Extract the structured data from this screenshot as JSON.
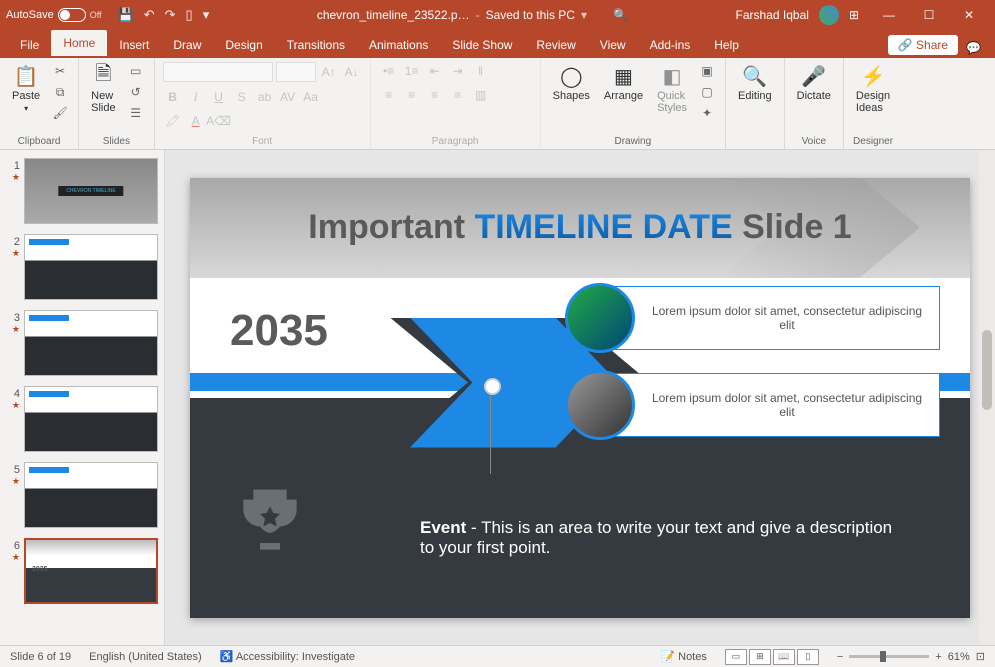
{
  "titlebar": {
    "autosave_label": "AutoSave",
    "autosave_state": "Off",
    "filename": "chevron_timeline_23522.p…",
    "save_state": "Saved to this PC",
    "user": "Farshad Iqbal"
  },
  "tabs": {
    "file": "File",
    "items": [
      "Home",
      "Insert",
      "Draw",
      "Design",
      "Transitions",
      "Animations",
      "Slide Show",
      "Review",
      "View",
      "Add-ins",
      "Help"
    ],
    "active": "Home",
    "share": "Share"
  },
  "ribbon": {
    "clipboard": {
      "paste": "Paste",
      "label": "Clipboard"
    },
    "slides": {
      "new_slide": "New\nSlide",
      "label": "Slides"
    },
    "font": {
      "label": "Font"
    },
    "paragraph": {
      "label": "Paragraph"
    },
    "drawing": {
      "shapes": "Shapes",
      "arrange": "Arrange",
      "quick": "Quick\nStyles",
      "label": "Drawing"
    },
    "editing": {
      "btn": "Editing"
    },
    "voice": {
      "dictate": "Dictate",
      "label": "Voice"
    },
    "designer": {
      "design_ideas": "Design\nIdeas",
      "label": "Designer"
    }
  },
  "thumbs": [
    {
      "num": "1"
    },
    {
      "num": "2"
    },
    {
      "num": "3"
    },
    {
      "num": "4"
    },
    {
      "num": "5"
    },
    {
      "num": "6"
    }
  ],
  "slide": {
    "title_pre": "Important ",
    "title_hl1": "TIMELINE",
    "title_mid": " ",
    "title_hl2": "DATE",
    "title_post": " Slide 1",
    "year": "2035",
    "callout1": "Lorem ipsum dolor sit amet, consectetur adipiscing elit",
    "callout2": "Lorem ipsum dolor sit amet, consectetur adipiscing elit",
    "event_label": "Event",
    "event_text": " - This is an area to write your text and give a description to your first point."
  },
  "status": {
    "slide_info": "Slide 6 of 19",
    "language": "English (United States)",
    "accessibility": "Accessibility: Investigate",
    "notes": "Notes",
    "zoom": "61%"
  }
}
